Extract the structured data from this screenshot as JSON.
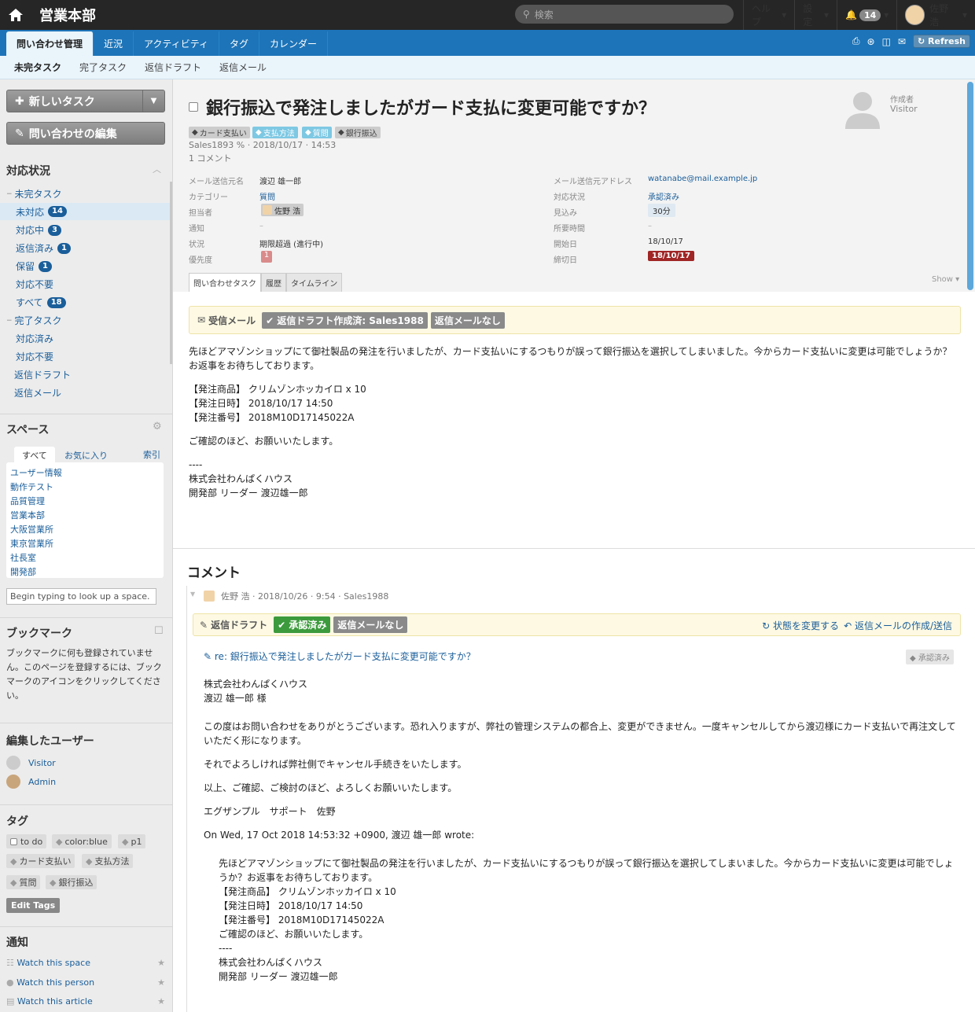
{
  "topbar": {
    "space": "営業本部",
    "search_placeholder": "検索",
    "help": "ヘルプ",
    "settings": "設定",
    "notif_count": "14",
    "user": "佐野 浩"
  },
  "nav": {
    "tabs": [
      "問い合わせ管理",
      "近況",
      "アクティビティ",
      "タグ",
      "カレンダー"
    ],
    "refresh": "Refresh"
  },
  "subnav": [
    "未完タスク",
    "完了タスク",
    "返信ドラフト",
    "返信メール"
  ],
  "sidebar": {
    "new_task": "新しいタスク",
    "edit_inquiry": "問い合わせの編集",
    "status_title": "対応状況",
    "incomplete": "未完タスク",
    "items": [
      {
        "label": "未対応",
        "count": "14"
      },
      {
        "label": "対応中",
        "count": "3"
      },
      {
        "label": "返信済み",
        "count": "1"
      },
      {
        "label": "保留",
        "count": "1"
      },
      {
        "label": "対応不要",
        "count": ""
      },
      {
        "label": "すべて",
        "count": "18"
      }
    ],
    "complete": "完了タスク",
    "complete_items": [
      "対応済み",
      "対応不要"
    ],
    "draft": "返信ドラフト",
    "reply": "返信メール",
    "space_title": "スペース",
    "space_tabs": [
      "すべて",
      "お気に入り",
      "索引"
    ],
    "spaces": [
      "ユーザー情報",
      "動作テスト",
      "品質管理",
      "営業本部",
      "大阪営業所",
      "東京営業所",
      "社長室",
      "開発部"
    ],
    "lookup_placeholder": "Begin typing to look up a space.",
    "bookmark_title": "ブックマーク",
    "bookmark_text": "ブックマークに何も登録されていません。このページを登録するには、ブックマークのアイコンをクリックしてください。",
    "editors_title": "編集したユーザー",
    "editors": [
      "Visitor",
      "Admin"
    ],
    "tags_title": "タグ",
    "tags": [
      "to do",
      "color:blue",
      "p1",
      "カード支払い",
      "支払方法",
      "質問",
      "銀行振込"
    ],
    "edit_tags": "Edit Tags",
    "notify_title": "通知",
    "watch": [
      "Watch this space",
      "Watch this person",
      "Watch this article"
    ]
  },
  "task": {
    "title": "銀行振込で発注しましたがガード支払に変更可能ですか？",
    "tags": [
      "カード支払い",
      "支払方法",
      "質問",
      "銀行振込"
    ],
    "meta1": "Sales1893 % · 2018/10/17 · 14:53",
    "meta2": "1 コメント",
    "creator_label": "作成者",
    "creator": "Visitor",
    "fields": {
      "sender_label": "メール送信元名",
      "sender": "渡辺 雄一郎",
      "category_label": "カテゴリー",
      "category": "質問",
      "assignee_label": "担当者",
      "assignee": "佐野 浩",
      "notify_label": "通知",
      "notify": "–",
      "state_label": "状況",
      "state": "期限超過 (進行中)",
      "priority_label": "優先度",
      "priority": "1",
      "addr_label": "メール送信元アドレス",
      "addr": "watanabe@mail.example.jp",
      "status_label": "対応状況",
      "status": "承認済み",
      "estimate_label": "見込み",
      "estimate": "30分",
      "time_label": "所要時間",
      "time": "–",
      "start_label": "開始日",
      "start": "18/10/17",
      "due_label": "締切日",
      "due": "18/10/17"
    },
    "subtabs": [
      "問い合わせタスク",
      "履歴",
      "タイムライン"
    ],
    "show": "Show"
  },
  "mail": {
    "label": "受信メール",
    "draft_chip": "返信ドラフト作成済: Sales1988",
    "nomail_chip": "返信メールなし",
    "lines": [
      "先ほどアマゾンショップにて御社製品の発注を行いましたが、カード支払いにするつもりが誤って銀行振込を選択してしまいました。今からカード支払いに変更は可能でしょうか？",
      "お返事をお待ちしております。",
      "【発注商品】 クリムゾンホッカイロ x 10",
      "【発注日時】 2018/10/17 14:50",
      "【発注番号】 2018M10D17145022A",
      "ご確認のほど、お願いいたします。",
      "----",
      "株式会社わんぱくハウス",
      "開発部 リーダー 渡辺雄一郎"
    ]
  },
  "comment": {
    "heading": "コメント",
    "meta": "佐野 浩 · 2018/10/26 · 9:54 · Sales1988",
    "draft_label": "返信ドラフト",
    "approved": "承認済み",
    "nomail": "返信メールなし",
    "change_state": "状態を変更する",
    "create_reply": "返信メールの作成/送信",
    "subject": "re: 銀行振込で発注しましたがガード支払に変更可能ですか？",
    "approved_tag": "承認済み",
    "body": [
      "株式会社わんぱくハウス",
      "渡辺 雄一郎 様",
      "この度はお問い合わせをありがとうございます。恐れ入りますが、弊社の管理システムの都合上、変更ができません。一度キャンセルしてから渡辺様にカード支払いで再注文して",
      "いただく形になります。",
      "それでよろしければ弊社側でキャンセル手続きをいたします。",
      "以上、ご確認、ご検討のほど、よろしくお願いいたします。",
      "エグザンプル　サポート　佐野",
      "On Wed, 17 Oct 2018 14:53:32 +0900, 渡辺 雄一郎 wrote:"
    ],
    "quote": [
      "先ほどアマゾンショップにて御社製品の発注を行いましたが、カード支払いにするつもりが誤って銀行振込を選択してしまいました。今からカード支払いに変更は可能でしょ",
      "うか？お返事をお待ちしております。",
      "【発注商品】 クリムゾンホッカイロ x 10",
      "【発注日時】 2018/10/17 14:50",
      "【発注番号】 2018M10D17145022A",
      "ご確認のほど、お願いいたします。",
      "----",
      "株式会社わんぱくハウス",
      "開発部 リーダー 渡辺雄一郎"
    ]
  }
}
